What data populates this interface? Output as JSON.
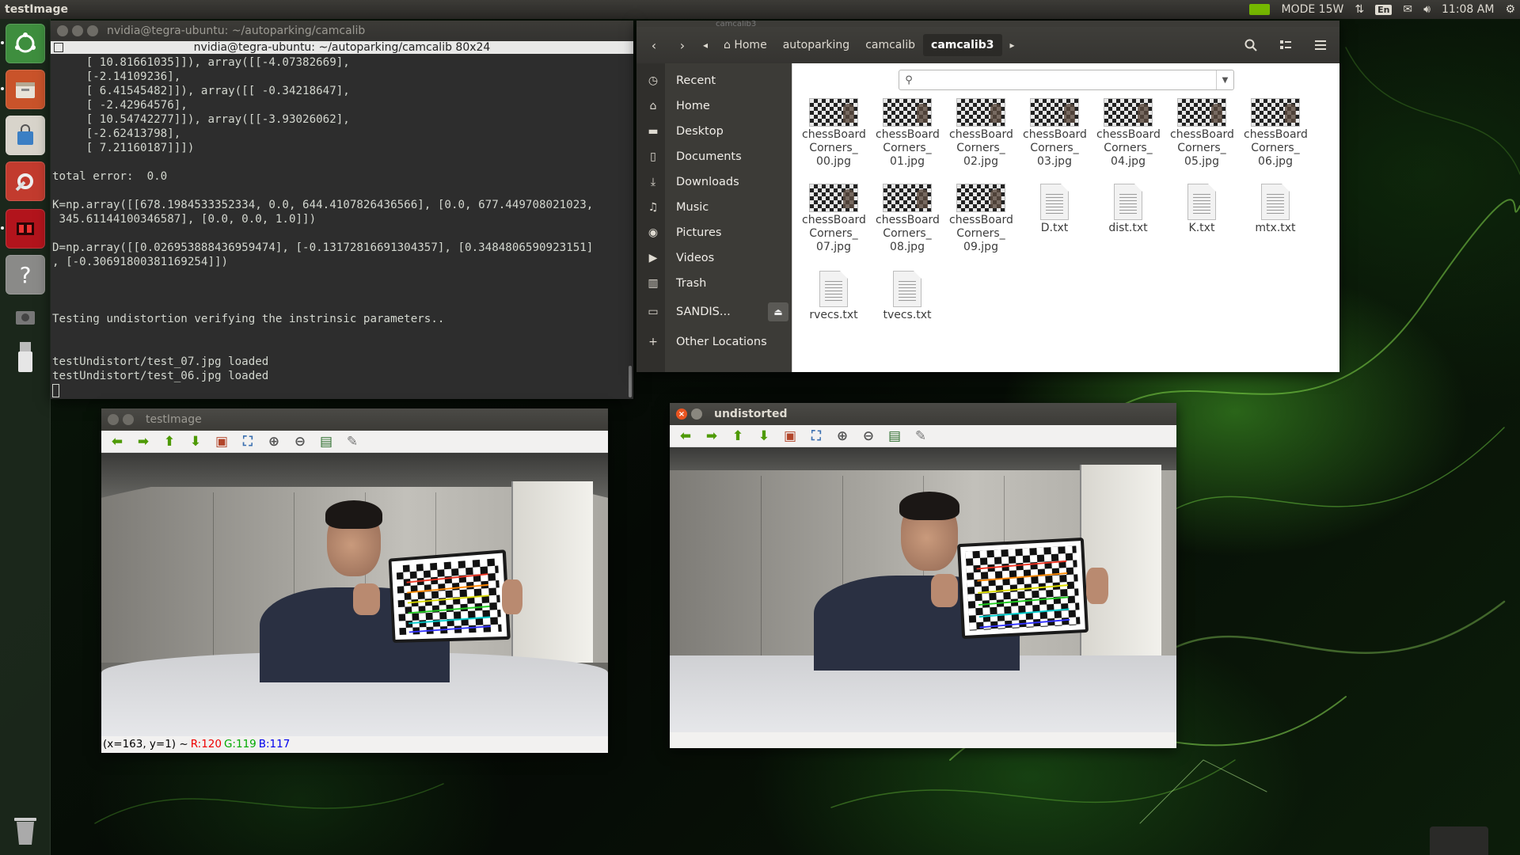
{
  "top_panel": {
    "app_title": "testImage",
    "mode": "MODE 15W",
    "lang": "En",
    "time": "11:08 AM"
  },
  "launcher": {
    "items": [
      "ubuntu-dash",
      "file-manager",
      "software-center",
      "system-settings",
      "gpu-monitor",
      "help",
      "screenshot",
      "usb-drive",
      "trash"
    ]
  },
  "terminal": {
    "title": "nvidia@tegra-ubuntu: ~/autoparking/camcalib",
    "tab_title": "nvidia@tegra-ubuntu: ~/autoparking/camcalib 80x24",
    "lines": [
      "     [ 10.81661035]]), array([[-4.07382669],",
      "     [-2.14109236],",
      "     [ 6.41545482]]), array([[ -0.34218647],",
      "     [ -2.42964576],",
      "     [ 10.54742277]]), array([[-3.93026062],",
      "     [-2.62413798],",
      "     [ 7.21160187]]])",
      "",
      "total error:  0.0",
      "",
      "K=np.array([[678.1984533352334, 0.0, 644.4107826436566], [0.0, 677.449708021023,",
      " 345.61144100346587], [0.0, 0.0, 1.0]])",
      "",
      "D=np.array([[0.026953888436959474], [-0.13172816691304357], [0.3484806590923151]",
      ", [-0.30691800381169254]])",
      "",
      "",
      "",
      "Testing undistortion verifying the instrinsic parameters..",
      "",
      "",
      "testUndistort/test_07.jpg loaded",
      "testUndistort/test_06.jpg loaded"
    ]
  },
  "files": {
    "window_title": "camcalib3",
    "breadcrumbs": [
      "Home",
      "autoparking",
      "camcalib",
      "camcalib3"
    ],
    "sidebar": [
      {
        "icon": "clock-icon",
        "label": "Recent"
      },
      {
        "icon": "home-icon",
        "label": "Home"
      },
      {
        "icon": "folder-icon",
        "label": "Desktop"
      },
      {
        "icon": "document-icon",
        "label": "Documents"
      },
      {
        "icon": "download-icon",
        "label": "Downloads"
      },
      {
        "icon": "music-icon",
        "label": "Music"
      },
      {
        "icon": "camera-icon",
        "label": "Pictures"
      },
      {
        "icon": "video-icon",
        "label": "Videos"
      },
      {
        "icon": "trash-icon",
        "label": "Trash"
      },
      {
        "icon": "drive-icon",
        "label": "SANDIS..."
      },
      {
        "icon": "plus-icon",
        "label": "Other Locations"
      }
    ],
    "search_placeholder": "",
    "items": [
      {
        "name": "chessBoard Corners_ 00.jpg",
        "kind": "image"
      },
      {
        "name": "chessBoard Corners_ 01.jpg",
        "kind": "image"
      },
      {
        "name": "chessBoard Corners_ 02.jpg",
        "kind": "image"
      },
      {
        "name": "chessBoard Corners_ 03.jpg",
        "kind": "image"
      },
      {
        "name": "chessBoard Corners_ 04.jpg",
        "kind": "image"
      },
      {
        "name": "chessBoard Corners_ 05.jpg",
        "kind": "image"
      },
      {
        "name": "chessBoard Corners_ 06.jpg",
        "kind": "image"
      },
      {
        "name": "chessBoard Corners_ 07.jpg",
        "kind": "image"
      },
      {
        "name": "chessBoard Corners_ 08.jpg",
        "kind": "image"
      },
      {
        "name": "chessBoard Corners_ 09.jpg",
        "kind": "image"
      },
      {
        "name": "D.txt",
        "kind": "text"
      },
      {
        "name": "dist.txt",
        "kind": "text"
      },
      {
        "name": "K.txt",
        "kind": "text"
      },
      {
        "name": "mtx.txt",
        "kind": "text"
      },
      {
        "name": "rvecs.txt",
        "kind": "text"
      },
      {
        "name": "tvecs.txt",
        "kind": "text"
      }
    ]
  },
  "viewer_test": {
    "title": "testImage",
    "status": {
      "coords": "(x=163, y=1) ~",
      "r": "R:120",
      "g": "G:119",
      "b": "B:117"
    }
  },
  "viewer_undist": {
    "title": "undistorted"
  },
  "viewer_toolbar": [
    "arrow-left-icon",
    "arrow-right-icon",
    "arrow-up-icon",
    "arrow-down-icon",
    "image-icon",
    "fit-icon",
    "zoom-in-icon",
    "zoom-out-icon",
    "save-icon",
    "properties-icon"
  ],
  "colors": {
    "accent_orange": "#e95420",
    "nvidia_green": "#76b900",
    "terminal_bg": "#2d2d2d",
    "panel_dark": "#3c3b37"
  }
}
